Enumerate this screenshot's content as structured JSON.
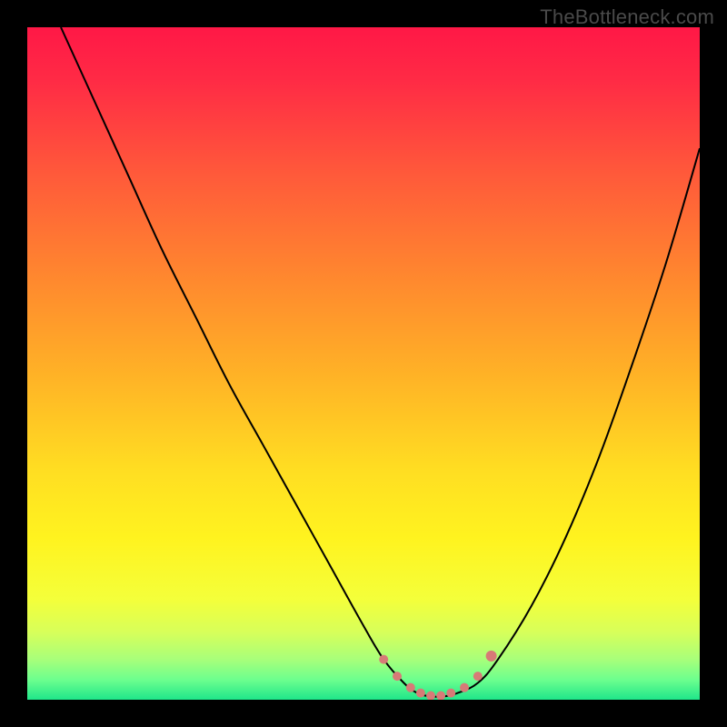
{
  "watermark": "TheBottleneck.com",
  "colors": {
    "frame": "#000000",
    "curve": "#000000",
    "marker_fill": "#d77a77",
    "marker_stroke": "#c55f5b",
    "gradient_stops": [
      {
        "offset": 0.0,
        "color": "#ff1846"
      },
      {
        "offset": 0.08,
        "color": "#ff2b45"
      },
      {
        "offset": 0.22,
        "color": "#ff5a3a"
      },
      {
        "offset": 0.38,
        "color": "#ff8a2e"
      },
      {
        "offset": 0.52,
        "color": "#ffb326"
      },
      {
        "offset": 0.66,
        "color": "#ffde22"
      },
      {
        "offset": 0.76,
        "color": "#fff31f"
      },
      {
        "offset": 0.85,
        "color": "#f4ff3a"
      },
      {
        "offset": 0.9,
        "color": "#d7ff5a"
      },
      {
        "offset": 0.94,
        "color": "#a8ff7a"
      },
      {
        "offset": 0.97,
        "color": "#6dff8e"
      },
      {
        "offset": 1.0,
        "color": "#1fe68a"
      }
    ]
  },
  "chart_data": {
    "type": "line",
    "title": "",
    "xlabel": "",
    "ylabel": "",
    "xlim": [
      0,
      100
    ],
    "ylim": [
      0,
      100
    ],
    "grid": false,
    "series": [
      {
        "name": "bottleneck-curve",
        "x": [
          5,
          10,
          15,
          20,
          25,
          30,
          35,
          40,
          45,
          50,
          53,
          56,
          58,
          60,
          62,
          64,
          67,
          70,
          75,
          80,
          85,
          90,
          95,
          100
        ],
        "y": [
          100,
          89,
          78,
          67,
          57,
          47,
          38,
          29,
          20,
          11,
          6,
          2.5,
          1,
          0.5,
          0.5,
          1,
          2.5,
          6,
          14,
          24,
          36,
          50,
          65,
          82
        ]
      }
    ],
    "markers": {
      "name": "highlight-region",
      "x": [
        53,
        55,
        57,
        58.5,
        60,
        61.5,
        63,
        65,
        67,
        69
      ],
      "y": [
        6,
        3.5,
        1.8,
        1,
        0.6,
        0.6,
        1,
        1.8,
        3.5,
        6.5
      ],
      "r": [
        5,
        5,
        5,
        5,
        5,
        5,
        5,
        5,
        5,
        6
      ]
    }
  }
}
